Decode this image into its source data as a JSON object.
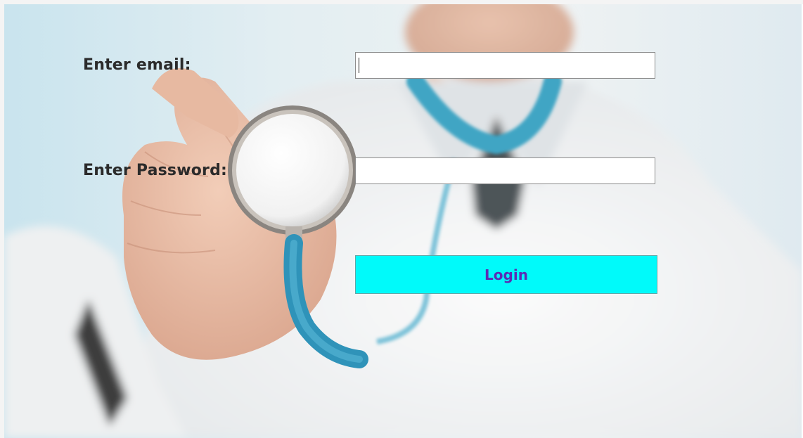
{
  "form": {
    "email_label": "Enter email:",
    "email_value": "",
    "password_label": "Enter Password:",
    "password_value": "",
    "login_label": "Login"
  },
  "background": {
    "image_subject": "doctor-holding-stethoscope-photo"
  },
  "colors": {
    "login_button_bg": "#00fafa",
    "login_button_text": "#5b2bb3",
    "label_text": "#2b2b2b"
  }
}
